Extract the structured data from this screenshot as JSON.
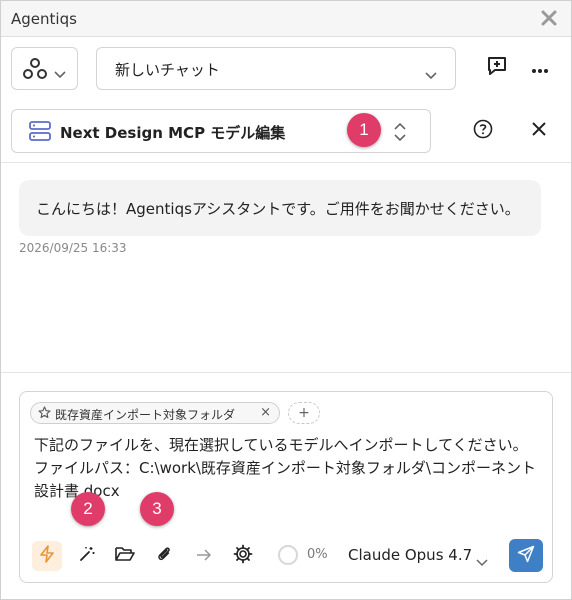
{
  "window": {
    "title": "Agentiqs"
  },
  "header": {
    "chat_select": {
      "value": "新しいチャット"
    }
  },
  "mcp": {
    "label": "Next Design MCP モデル編集"
  },
  "badges": {
    "b1": "1",
    "b2": "2",
    "b3": "3"
  },
  "chat": {
    "messages": [
      {
        "text": "こんにちは！Agentiqsアシスタントです。ご用件をお聞かせください。",
        "timestamp": "2026/09/25 16:33"
      }
    ]
  },
  "composer": {
    "attachment_chip": "既存資産インポート対象フォルダ",
    "add_chip": "+",
    "input_text": "下記のファイルを、現在選択しているモデルへインポートしてください。\nファイルパス：C:\\work\\既存資産インポート対象フォルダ\\コンポーネント設計書.docx",
    "progress_label": "0%",
    "progress": 0,
    "model": "Claude Opus 4.7"
  },
  "colors": {
    "accent": "#3f7fc6",
    "badge": "#e03c6a",
    "active_tool": "#fdeede",
    "lightning": "#e8953a",
    "server_icon": "#5b6cc9"
  },
  "icons": [
    "close-icon",
    "agents-icon",
    "chevron-down-icon",
    "new-chat-icon",
    "more-icon",
    "server-icon",
    "chevron-updown-icon",
    "help-icon",
    "star-icon",
    "lightning-icon",
    "magic-wand-icon",
    "folder-open-icon",
    "paperclip-icon",
    "arrow-right-icon",
    "gear-icon",
    "send-icon"
  ]
}
